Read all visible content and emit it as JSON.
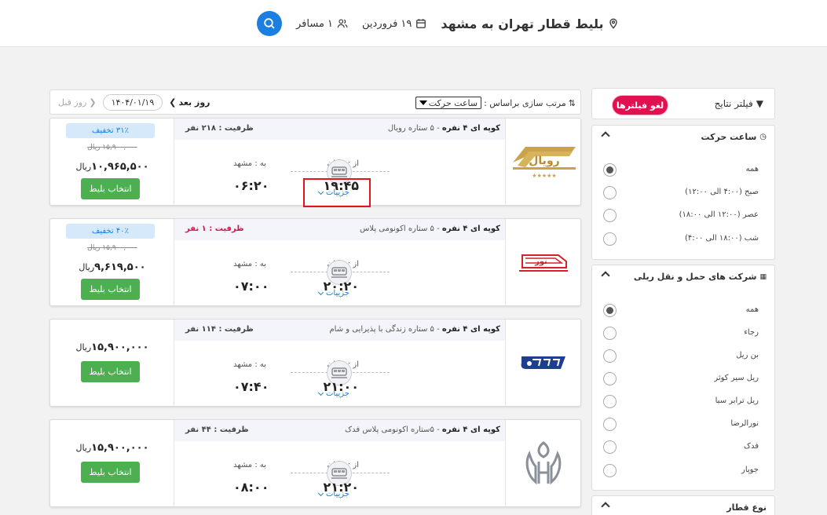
{
  "search": {
    "title": "بلیط قطار تهران به مشهد",
    "date": "۱۹ فروردین",
    "passengers": "۱ مسافر",
    "icons": {
      "location": "location-pin-icon",
      "calendar": "calendar-icon",
      "passengers": "users-icon",
      "search": "search-icon"
    }
  },
  "filters": {
    "header_title": "فیلتر نتایج",
    "clear_label": "لغو فیلترها",
    "departure_time": {
      "title": "ساعت حرکت",
      "options": [
        "همه",
        "صبح (۴:۰۰ الی ۱۲:۰۰)",
        "عصر (۱۲:۰۰ الی ۱۸:۰۰)",
        "شب (۱۸:۰۰ الی ۴:۰۰)"
      ]
    },
    "companies": {
      "title": "شرکت های حمل و نقل ریلی",
      "options": [
        "همه",
        "رجاء",
        "بن ریل",
        "ریل سیر کوثر",
        "ریل ترابر سبا",
        "نورالرضا",
        "فدک",
        "جوپار"
      ]
    },
    "train_type": {
      "title": "نوع قطار"
    }
  },
  "toolbar": {
    "sort_label": "مرتب سازی براساس :",
    "sort_value": "ساعت حرکت",
    "next_day": "روز بعد",
    "date": "۱۴۰۴/۰۱/۱۹",
    "prev_day": "روز قبل"
  },
  "common": {
    "from": "از : تهران",
    "to": "به : مشهد",
    "details": "جزییات",
    "select": "انتخاب بلیط",
    "currency": "ریال"
  },
  "tickets": [
    {
      "desc_bold": "کوپه ای ۴ نفره",
      "desc": " - ۵ ستاره رویال",
      "capacity": "ظرفیت : ۲۱۸ نفر",
      "dep": "۱۹:۴۵",
      "arr": "۰۶:۲۰",
      "discount": "۳۱٪ تخفیف",
      "old_price": "۱۵,۹۰۰,۰۰۰ ریال",
      "price": "۱۰,۹۶۵,۵۰۰",
      "logo": "royal-rail-logo"
    },
    {
      "desc_bold": "کوپه ای ۴ نفره",
      "desc": " - ۵ ستاره اکونومی پلاس",
      "capacity": "ظرفیت : ۱ نفر",
      "dep": "۲۰:۲۰",
      "arr": "۰۷:۰۰",
      "discount": "۴۰٪ تخفیف",
      "old_price": "۱۵,۹۰۰,۰۰۰ ریال",
      "price": "۹,۶۱۹,۵۰۰",
      "logo": "noor-rail-logo"
    },
    {
      "desc_bold": "کوپه ای ۴ نفره",
      "desc": " - ۵ ستاره زندگی با پذیرایی و شام",
      "capacity": "ظرفیت : ۱۱۴ نفر",
      "dep": "۲۱:۰۰",
      "arr": "۰۷:۴۰",
      "price": "۱۵,۹۰۰,۰۰۰",
      "logo": "blue-train-logo"
    },
    {
      "desc_bold": "کوپه ای ۴ نفره",
      "desc": " - ۵ستاره اکونومی پلاس فدک",
      "capacity": "ظرفیت : ۴۴ نفر",
      "dep": "۲۱:۲۰",
      "arr": "۰۸:۰۰",
      "price": "۱۵,۹۰۰,۰۰۰",
      "logo": "fadak-logo"
    }
  ],
  "colors": {
    "accent": "#1a7fe0",
    "danger": "#e0114e",
    "success": "#4caf50"
  }
}
